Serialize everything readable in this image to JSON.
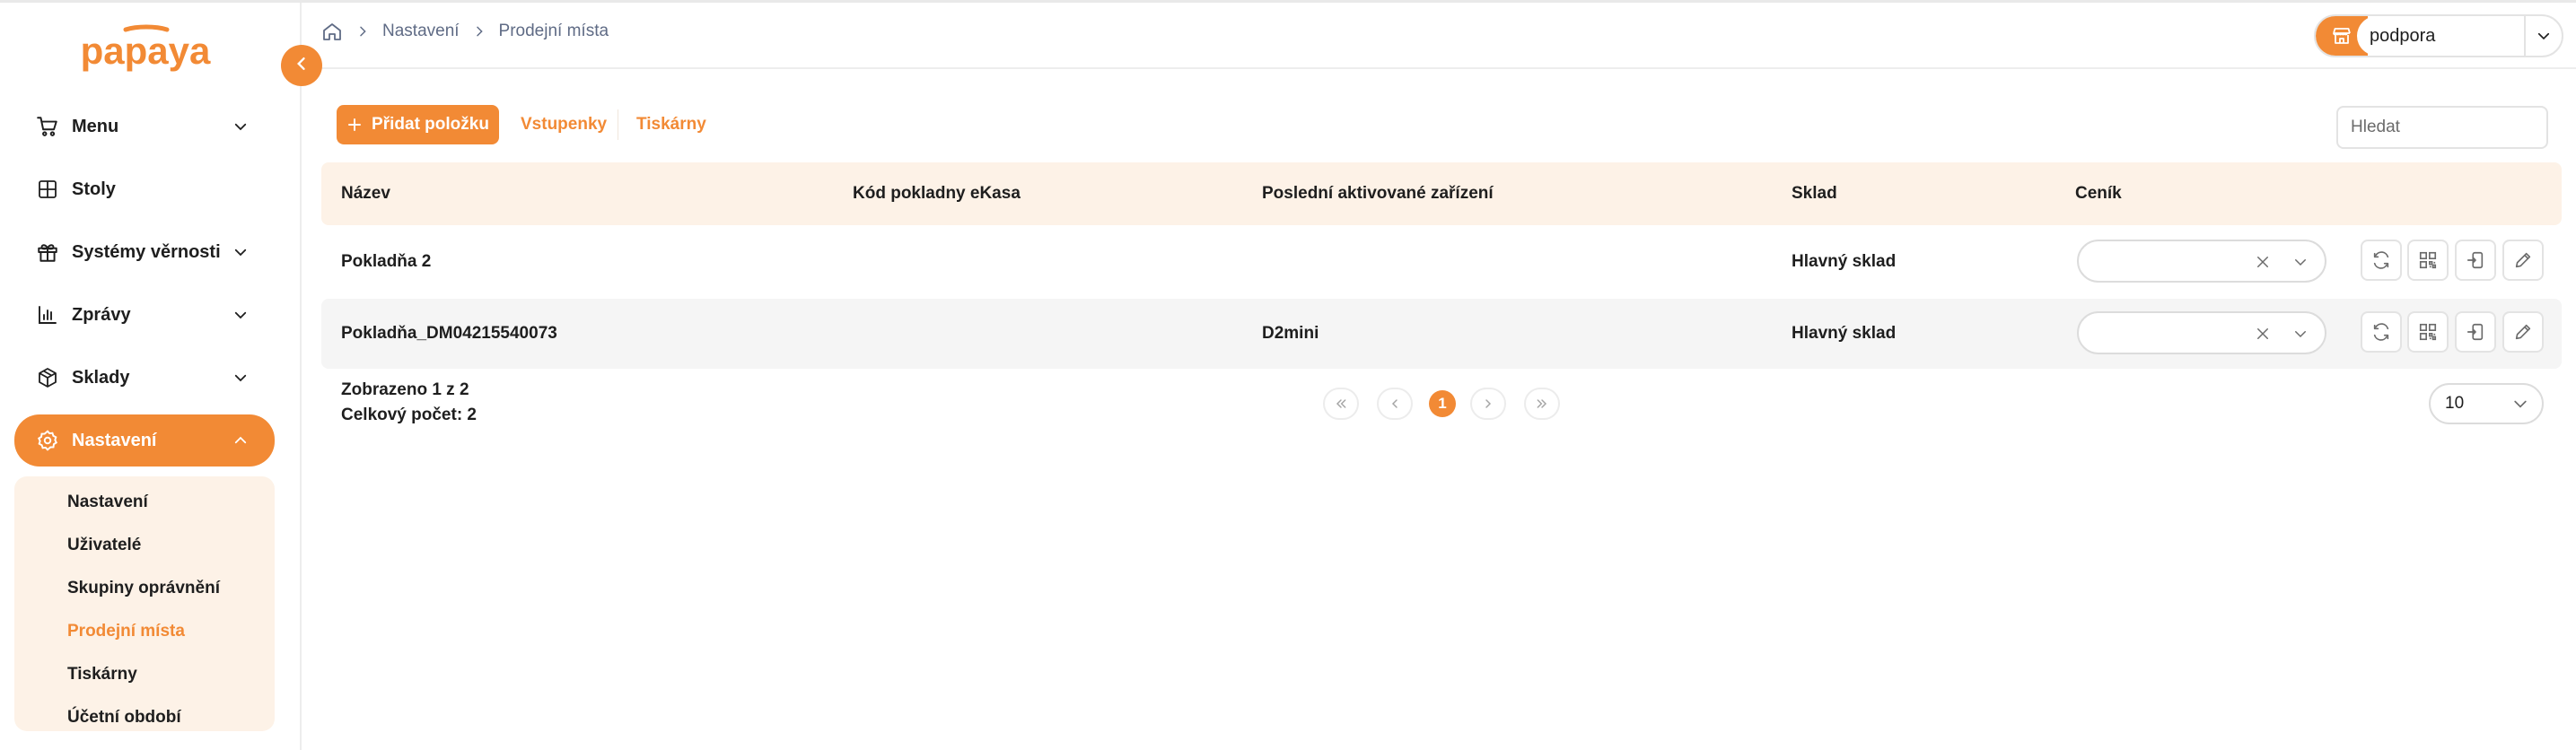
{
  "app": {
    "logo_text": "papaya"
  },
  "colors": {
    "accent": "#f28a35",
    "accent_light": "#fdf2e7",
    "text": "#1e1e1e",
    "muted": "#5f6b85"
  },
  "sidebar": {
    "items": [
      {
        "label": "Menu",
        "icon": "cart-icon",
        "has_chevron": true
      },
      {
        "label": "Stoly",
        "icon": "table-grid-icon",
        "has_chevron": false
      },
      {
        "label": "Systémy věrnosti",
        "icon": "gift-icon",
        "has_chevron": true
      },
      {
        "label": "Zprávy",
        "icon": "bar-chart-icon",
        "has_chevron": true
      },
      {
        "label": "Sklady",
        "icon": "box-icon",
        "has_chevron": true
      },
      {
        "label": "Nastavení",
        "icon": "gear-icon",
        "has_chevron": true,
        "active": true
      }
    ],
    "submenu": [
      {
        "label": "Nastavení"
      },
      {
        "label": "Uživatelé"
      },
      {
        "label": "Skupiny oprávnění"
      },
      {
        "label": "Prodejní místa",
        "active": true
      },
      {
        "label": "Tiskárny"
      },
      {
        "label": "Účetní období"
      }
    ]
  },
  "header": {
    "breadcrumb": [
      "Nastavení",
      "Prodejní místa"
    ],
    "store_value": "podpora"
  },
  "toolbar": {
    "add_label": "Přidat položku",
    "tabs": [
      "Vstupenky",
      "Tiskárny"
    ],
    "search_placeholder": "Hledat"
  },
  "table": {
    "columns": [
      "Název",
      "Kód pokladny eKasa",
      "Poslední aktivované zařízení",
      "Sklad",
      "Ceník"
    ],
    "rows": [
      {
        "name": "Pokladňa 2",
        "ekasa": "",
        "device": "",
        "warehouse": "Hlavný sklad",
        "pricelist": ""
      },
      {
        "name": "Pokladňa_DM04215540073",
        "ekasa": "",
        "device": "D2mini",
        "warehouse": "Hlavný sklad",
        "pricelist": ""
      }
    ]
  },
  "footer": {
    "shown": "Zobrazeno 1 z 2",
    "total": "Celkový počet: 2",
    "current_page": "1",
    "page_size": "10"
  }
}
